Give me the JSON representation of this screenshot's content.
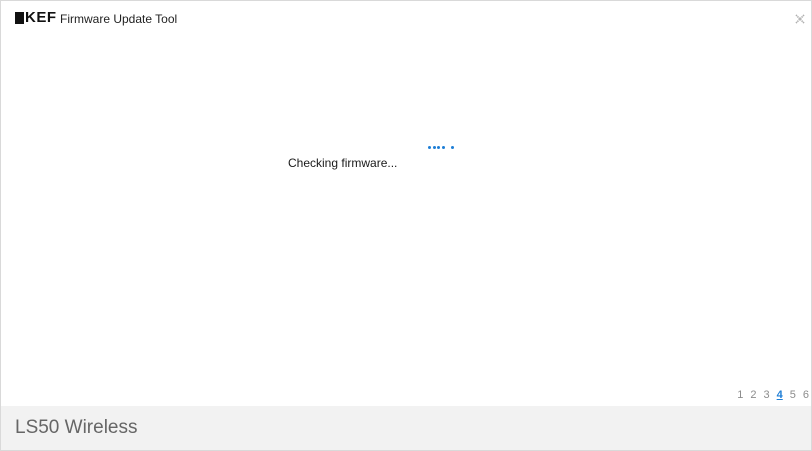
{
  "app": {
    "brand": "KEF",
    "title": "Firmware Update Tool"
  },
  "status": {
    "message": "Checking firmware..."
  },
  "steps": {
    "items": [
      "1",
      "2",
      "3",
      "4",
      "5",
      "6"
    ],
    "active": "4"
  },
  "footer": {
    "device": "LS50 Wireless"
  },
  "icons": {
    "close": "close-icon",
    "spinner": "loading-spinner-icon",
    "logo": "kef-logo"
  },
  "colors": {
    "accent": "#1e7ed6",
    "footer_bg": "#f2f2f2",
    "step_text": "#8c8c8c",
    "device_text": "#666666"
  }
}
